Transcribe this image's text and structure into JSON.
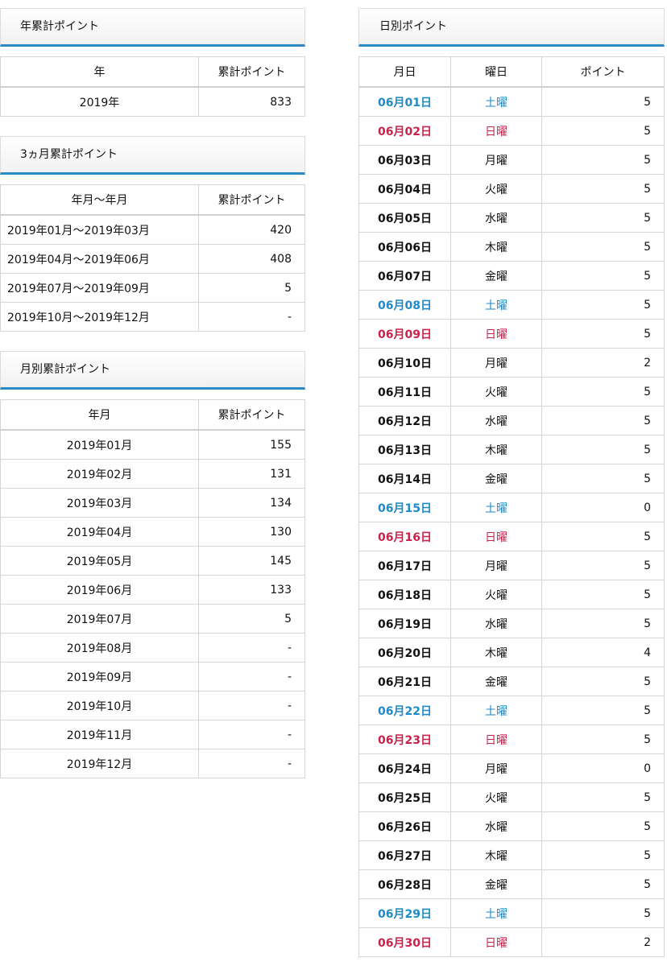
{
  "annual": {
    "title": "年累計ポイント",
    "headers": [
      "年",
      "累計ポイント"
    ],
    "rows": [
      {
        "period": "2019年",
        "points": "833"
      }
    ]
  },
  "quarterly": {
    "title": "3ヵ月累計ポイント",
    "headers": [
      "年月～年月",
      "累計ポイント"
    ],
    "rows": [
      {
        "period": "2019年01月～2019年03月",
        "points": "420"
      },
      {
        "period": "2019年04月～2019年06月",
        "points": "408"
      },
      {
        "period": "2019年07月～2019年09月",
        "points": "5"
      },
      {
        "period": "2019年10月～2019年12月",
        "points": "-"
      }
    ]
  },
  "monthly": {
    "title": "月別累計ポイント",
    "headers": [
      "年月",
      "累計ポイント"
    ],
    "rows": [
      {
        "period": "2019年01月",
        "points": "155"
      },
      {
        "period": "2019年02月",
        "points": "131"
      },
      {
        "period": "2019年03月",
        "points": "134"
      },
      {
        "period": "2019年04月",
        "points": "130"
      },
      {
        "period": "2019年05月",
        "points": "145"
      },
      {
        "period": "2019年06月",
        "points": "133"
      },
      {
        "period": "2019年07月",
        "points": "5"
      },
      {
        "period": "2019年08月",
        "points": "-"
      },
      {
        "period": "2019年09月",
        "points": "-"
      },
      {
        "period": "2019年10月",
        "points": "-"
      },
      {
        "period": "2019年11月",
        "points": "-"
      },
      {
        "period": "2019年12月",
        "points": "-"
      }
    ]
  },
  "daily": {
    "title": "日別ポイント",
    "headers": [
      "月日",
      "曜日",
      "ポイント"
    ],
    "colors": {
      "saturday": "#1e8ac8",
      "sunday": "#c8234b"
    },
    "rows": [
      {
        "date": "06月01日",
        "weekday": "土曜",
        "points": "5",
        "kind": "sat"
      },
      {
        "date": "06月02日",
        "weekday": "日曜",
        "points": "5",
        "kind": "sun"
      },
      {
        "date": "06月03日",
        "weekday": "月曜",
        "points": "5",
        "kind": ""
      },
      {
        "date": "06月04日",
        "weekday": "火曜",
        "points": "5",
        "kind": ""
      },
      {
        "date": "06月05日",
        "weekday": "水曜",
        "points": "5",
        "kind": ""
      },
      {
        "date": "06月06日",
        "weekday": "木曜",
        "points": "5",
        "kind": ""
      },
      {
        "date": "06月07日",
        "weekday": "金曜",
        "points": "5",
        "kind": ""
      },
      {
        "date": "06月08日",
        "weekday": "土曜",
        "points": "5",
        "kind": "sat"
      },
      {
        "date": "06月09日",
        "weekday": "日曜",
        "points": "5",
        "kind": "sun"
      },
      {
        "date": "06月10日",
        "weekday": "月曜",
        "points": "2",
        "kind": ""
      },
      {
        "date": "06月11日",
        "weekday": "火曜",
        "points": "5",
        "kind": ""
      },
      {
        "date": "06月12日",
        "weekday": "水曜",
        "points": "5",
        "kind": ""
      },
      {
        "date": "06月13日",
        "weekday": "木曜",
        "points": "5",
        "kind": ""
      },
      {
        "date": "06月14日",
        "weekday": "金曜",
        "points": "5",
        "kind": ""
      },
      {
        "date": "06月15日",
        "weekday": "土曜",
        "points": "0",
        "kind": "sat"
      },
      {
        "date": "06月16日",
        "weekday": "日曜",
        "points": "5",
        "kind": "sun"
      },
      {
        "date": "06月17日",
        "weekday": "月曜",
        "points": "5",
        "kind": ""
      },
      {
        "date": "06月18日",
        "weekday": "火曜",
        "points": "5",
        "kind": ""
      },
      {
        "date": "06月19日",
        "weekday": "水曜",
        "points": "5",
        "kind": ""
      },
      {
        "date": "06月20日",
        "weekday": "木曜",
        "points": "4",
        "kind": ""
      },
      {
        "date": "06月21日",
        "weekday": "金曜",
        "points": "5",
        "kind": ""
      },
      {
        "date": "06月22日",
        "weekday": "土曜",
        "points": "5",
        "kind": "sat"
      },
      {
        "date": "06月23日",
        "weekday": "日曜",
        "points": "5",
        "kind": "sun"
      },
      {
        "date": "06月24日",
        "weekday": "月曜",
        "points": "0",
        "kind": ""
      },
      {
        "date": "06月25日",
        "weekday": "火曜",
        "points": "5",
        "kind": ""
      },
      {
        "date": "06月26日",
        "weekday": "水曜",
        "points": "5",
        "kind": ""
      },
      {
        "date": "06月27日",
        "weekday": "木曜",
        "points": "5",
        "kind": ""
      },
      {
        "date": "06月28日",
        "weekday": "金曜",
        "points": "5",
        "kind": ""
      },
      {
        "date": "06月29日",
        "weekday": "土曜",
        "points": "5",
        "kind": "sat"
      },
      {
        "date": "06月30日",
        "weekday": "日曜",
        "points": "2",
        "kind": "sun"
      }
    ]
  }
}
